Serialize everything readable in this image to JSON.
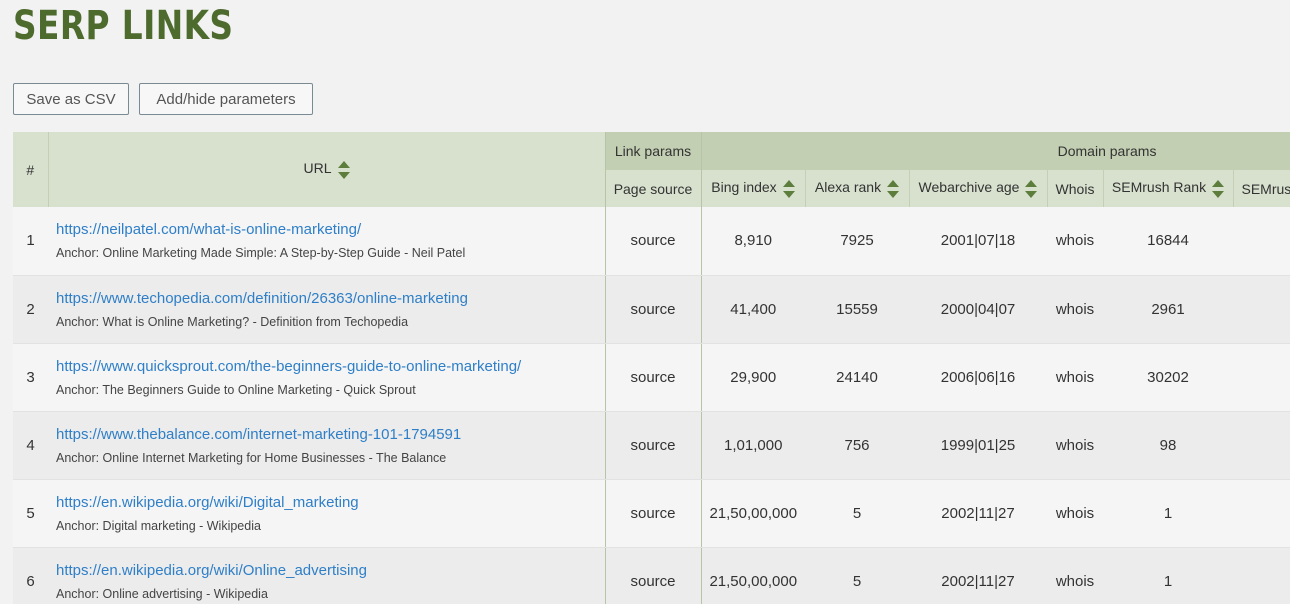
{
  "page": {
    "title": "SERP LINKS"
  },
  "toolbar": {
    "save_label": "Save as CSV",
    "params_label": "Add/hide parameters"
  },
  "table": {
    "header": {
      "num": "#",
      "url": "URL",
      "link_params": "Link params",
      "domain_params": "Domain params",
      "page_source": "Page source",
      "bing_index": "Bing index",
      "alexa_rank": "Alexa rank",
      "webarchive_age": "Webarchive age",
      "whois": "Whois",
      "semrush_rank": "SEMrush Rank",
      "semrush_more": "SEMrus"
    },
    "rows": [
      {
        "num": "1",
        "url": "https://neilpatel.com/what-is-online-marketing/",
        "anchor": "Anchor: Online Marketing Made Simple: A Step-by-Step Guide - Neil Patel",
        "source": "source",
        "bing": "8,910",
        "alexa": "7925",
        "age": "2001|07|18",
        "whois": "whois",
        "semrush": "16844"
      },
      {
        "num": "2",
        "url": "https://www.techopedia.com/definition/26363/online-marketing",
        "anchor": "Anchor: What is Online Marketing? - Definition from Techopedia",
        "source": "source",
        "bing": "41,400",
        "alexa": "15559",
        "age": "2000|04|07",
        "whois": "whois",
        "semrush": "2961"
      },
      {
        "num": "3",
        "url": "https://www.quicksprout.com/the-beginners-guide-to-online-marketing/",
        "anchor": "Anchor: The Beginners Guide to Online Marketing - Quick Sprout",
        "source": "source",
        "bing": "29,900",
        "alexa": "24140",
        "age": "2006|06|16",
        "whois": "whois",
        "semrush": "30202"
      },
      {
        "num": "4",
        "url": "https://www.thebalance.com/internet-marketing-101-1794591",
        "anchor": "Anchor: Online Internet Marketing for Home Businesses - The Balance",
        "source": "source",
        "bing": "1,01,000",
        "alexa": "756",
        "age": "1999|01|25",
        "whois": "whois",
        "semrush": "98"
      },
      {
        "num": "5",
        "url": "https://en.wikipedia.org/wiki/Digital_marketing",
        "anchor": "Anchor: Digital marketing - Wikipedia",
        "source": "source",
        "bing": "21,50,00,000",
        "alexa": "5",
        "age": "2002|11|27",
        "whois": "whois",
        "semrush": "1"
      },
      {
        "num": "6",
        "url": "https://en.wikipedia.org/wiki/Online_advertising",
        "anchor": "Anchor: Online advertising - Wikipedia",
        "source": "source",
        "bing": "21,50,00,000",
        "alexa": "5",
        "age": "2002|11|27",
        "whois": "whois",
        "semrush": "1"
      }
    ]
  }
}
